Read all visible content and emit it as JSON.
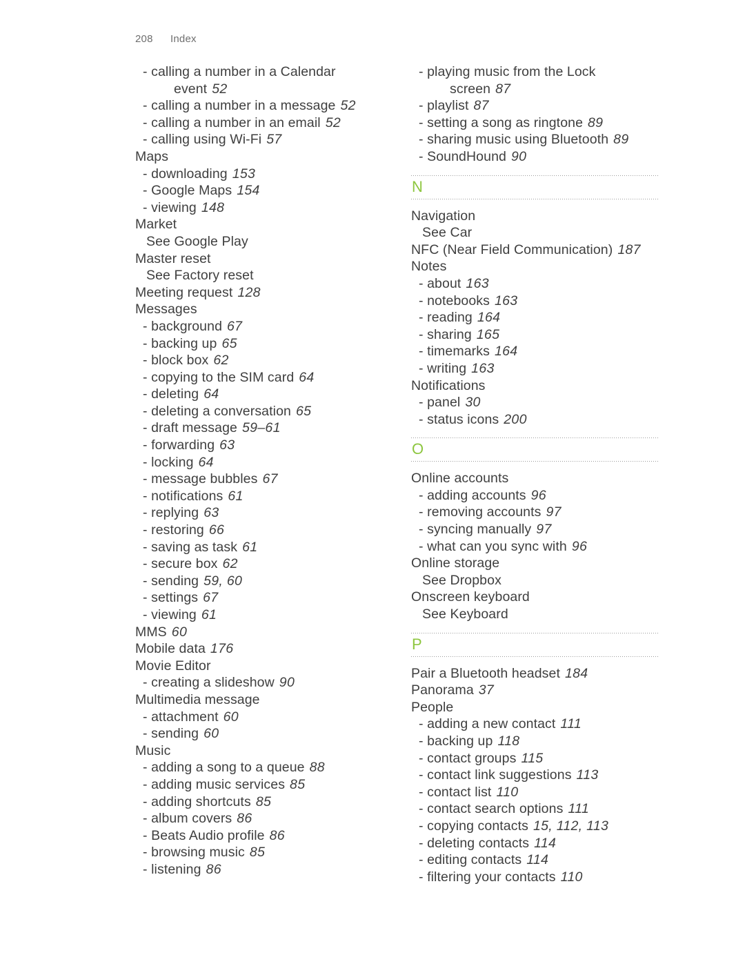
{
  "page": {
    "folio": "208",
    "section_label": "Index",
    "accent_color": "#8DC63F",
    "text_color": "#3f3f3f"
  },
  "columns": {
    "left": [
      {
        "type": "sub",
        "text": "calling a number in a Calendar",
        "page": ""
      },
      {
        "type": "cont",
        "text": "event",
        "page": "52"
      },
      {
        "type": "sub",
        "text": "calling a number in a message",
        "page": "52"
      },
      {
        "type": "sub",
        "text": "calling a number in an email",
        "page": "52"
      },
      {
        "type": "sub",
        "text": "calling using Wi-Fi",
        "page": "57"
      },
      {
        "type": "main",
        "text": "Maps",
        "page": ""
      },
      {
        "type": "sub",
        "text": "downloading",
        "page": "153"
      },
      {
        "type": "sub",
        "text": "Google Maps",
        "page": "154"
      },
      {
        "type": "sub",
        "text": "viewing",
        "page": "148"
      },
      {
        "type": "main",
        "text": "Market",
        "page": ""
      },
      {
        "type": "see",
        "text": "See Google Play",
        "page": ""
      },
      {
        "type": "main",
        "text": "Master reset",
        "page": ""
      },
      {
        "type": "see",
        "text": "See Factory reset",
        "page": ""
      },
      {
        "type": "main",
        "text": "Meeting request",
        "page": "128"
      },
      {
        "type": "main",
        "text": "Messages",
        "page": ""
      },
      {
        "type": "sub",
        "text": "background",
        "page": "67"
      },
      {
        "type": "sub",
        "text": "backing up",
        "page": "65"
      },
      {
        "type": "sub",
        "text": "block box",
        "page": "62"
      },
      {
        "type": "sub",
        "text": "copying to the SIM card",
        "page": "64"
      },
      {
        "type": "sub",
        "text": "deleting",
        "page": "64"
      },
      {
        "type": "sub",
        "text": "deleting a conversation",
        "page": "65"
      },
      {
        "type": "sub",
        "text": "draft message",
        "page": "59–61"
      },
      {
        "type": "sub",
        "text": "forwarding",
        "page": "63"
      },
      {
        "type": "sub",
        "text": "locking",
        "page": "64"
      },
      {
        "type": "sub",
        "text": "message bubbles",
        "page": "67"
      },
      {
        "type": "sub",
        "text": "notifications",
        "page": "61"
      },
      {
        "type": "sub",
        "text": "replying",
        "page": "63"
      },
      {
        "type": "sub",
        "text": "restoring",
        "page": "66"
      },
      {
        "type": "sub",
        "text": "saving as task",
        "page": "61"
      },
      {
        "type": "sub",
        "text": "secure box",
        "page": "62"
      },
      {
        "type": "sub",
        "text": "sending",
        "page": "59, 60"
      },
      {
        "type": "sub",
        "text": "settings",
        "page": "67"
      },
      {
        "type": "sub",
        "text": "viewing",
        "page": "61"
      },
      {
        "type": "main",
        "text": "MMS",
        "page": "60"
      },
      {
        "type": "main",
        "text": "Mobile data",
        "page": "176"
      },
      {
        "type": "main",
        "text": "Movie Editor",
        "page": ""
      },
      {
        "type": "sub",
        "text": "creating a slideshow",
        "page": "90"
      },
      {
        "type": "main",
        "text": "Multimedia message",
        "page": ""
      },
      {
        "type": "sub",
        "text": "attachment",
        "page": "60"
      },
      {
        "type": "sub",
        "text": "sending",
        "page": "60"
      },
      {
        "type": "main",
        "text": "Music",
        "page": ""
      },
      {
        "type": "sub",
        "text": "adding a song to a queue",
        "page": "88"
      },
      {
        "type": "sub",
        "text": "adding music services",
        "page": "85"
      },
      {
        "type": "sub",
        "text": "adding shortcuts",
        "page": "85"
      },
      {
        "type": "sub",
        "text": "album covers",
        "page": "86"
      },
      {
        "type": "sub",
        "text": "Beats Audio profile",
        "page": "86"
      },
      {
        "type": "sub",
        "text": "browsing music",
        "page": "85"
      },
      {
        "type": "sub",
        "text": "listening",
        "page": "86"
      }
    ],
    "right": [
      {
        "type": "sub",
        "text": "playing music from the Lock",
        "page": ""
      },
      {
        "type": "cont",
        "text": "screen",
        "page": "87"
      },
      {
        "type": "sub",
        "text": "playlist",
        "page": "87"
      },
      {
        "type": "sub",
        "text": "setting a song as ringtone",
        "page": "89"
      },
      {
        "type": "sub",
        "text": "sharing music using Bluetooth",
        "page": "89"
      },
      {
        "type": "sub",
        "text": "SoundHound",
        "page": "90"
      },
      {
        "type": "letter",
        "text": "N",
        "page": ""
      },
      {
        "type": "main",
        "text": "Navigation",
        "page": ""
      },
      {
        "type": "see",
        "text": "See Car",
        "page": ""
      },
      {
        "type": "main",
        "text": "NFC (Near Field Communication)",
        "page": "187"
      },
      {
        "type": "main",
        "text": "Notes",
        "page": ""
      },
      {
        "type": "sub",
        "text": "about",
        "page": "163"
      },
      {
        "type": "sub",
        "text": "notebooks",
        "page": "163"
      },
      {
        "type": "sub",
        "text": "reading",
        "page": "164"
      },
      {
        "type": "sub",
        "text": "sharing",
        "page": "165"
      },
      {
        "type": "sub",
        "text": "timemarks",
        "page": "164"
      },
      {
        "type": "sub",
        "text": "writing",
        "page": "163"
      },
      {
        "type": "main",
        "text": "Notifications",
        "page": ""
      },
      {
        "type": "sub",
        "text": "panel",
        "page": "30"
      },
      {
        "type": "sub",
        "text": "status icons",
        "page": "200"
      },
      {
        "type": "letter",
        "text": "O",
        "page": ""
      },
      {
        "type": "main",
        "text": "Online accounts",
        "page": ""
      },
      {
        "type": "sub",
        "text": "adding accounts",
        "page": "96"
      },
      {
        "type": "sub",
        "text": "removing accounts",
        "page": "97"
      },
      {
        "type": "sub",
        "text": "syncing manually",
        "page": "97"
      },
      {
        "type": "sub",
        "text": "what can you sync with",
        "page": "96"
      },
      {
        "type": "main",
        "text": "Online storage",
        "page": ""
      },
      {
        "type": "see",
        "text": "See Dropbox",
        "page": ""
      },
      {
        "type": "main",
        "text": "Onscreen keyboard",
        "page": ""
      },
      {
        "type": "see",
        "text": "See Keyboard",
        "page": ""
      },
      {
        "type": "letter",
        "text": "P",
        "page": ""
      },
      {
        "type": "main",
        "text": "Pair a Bluetooth headset",
        "page": "184"
      },
      {
        "type": "main",
        "text": "Panorama",
        "page": "37"
      },
      {
        "type": "main",
        "text": "People",
        "page": ""
      },
      {
        "type": "sub",
        "text": "adding a new contact",
        "page": "111"
      },
      {
        "type": "sub",
        "text": "backing up",
        "page": "118"
      },
      {
        "type": "sub",
        "text": "contact groups",
        "page": "115"
      },
      {
        "type": "sub",
        "text": "contact link suggestions",
        "page": "113"
      },
      {
        "type": "sub",
        "text": "contact list",
        "page": "110"
      },
      {
        "type": "sub",
        "text": "contact search options",
        "page": "111"
      },
      {
        "type": "sub",
        "text": "copying contacts",
        "page": "15, 112, 113"
      },
      {
        "type": "sub",
        "text": "deleting contacts",
        "page": "114"
      },
      {
        "type": "sub",
        "text": "editing contacts",
        "page": "114"
      },
      {
        "type": "sub",
        "text": "filtering your contacts",
        "page": "110"
      }
    ]
  }
}
